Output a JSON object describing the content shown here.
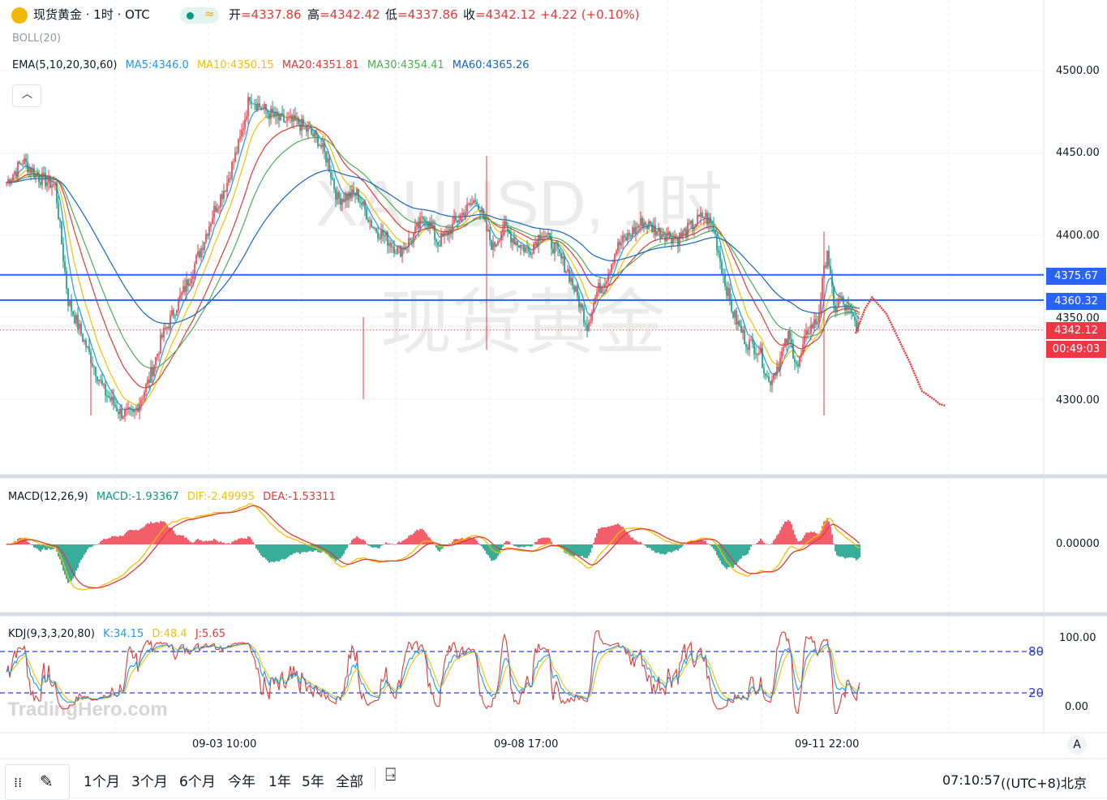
{
  "header": {
    "symbol": "现货黄金 · 1时 · OTC",
    "open_label": "开",
    "open": "=4337.86",
    "high_label": "高",
    "high": "=4342.42",
    "low_label": "低",
    "low": "=4337.86",
    "close_label": "收",
    "close": "=4342.12",
    "change": "+4.22 (+0.10%)",
    "boll": "BOLL(20)"
  },
  "ema_legend": {
    "label": "EMA(5,10,20,30,60)",
    "items": [
      {
        "text": "MA5:4346.0",
        "color": "#2196f3"
      },
      {
        "text": "MA10:4350.15",
        "color": "#f5c000"
      },
      {
        "text": "MA20:4351.81",
        "color": "#e53935"
      },
      {
        "text": "MA30:4354.41",
        "color": "#4caf50"
      },
      {
        "text": "MA60:4365.26",
        "color": "#1565c0"
      }
    ]
  },
  "watermark": {
    "symbol": "XAUUSD, 1时",
    "name": "现货黄金",
    "brand": "TradingHero.com"
  },
  "price_axis": {
    "ticks": [
      "4500.00",
      "4450.00",
      "4400.00",
      "4350.00",
      "4300.00"
    ]
  },
  "price_tags": {
    "level1": "4375.67",
    "level2": "4360.32",
    "current": "4342.12",
    "countdown": "00:49:03"
  },
  "macd": {
    "label": "MACD(12,26,9)",
    "macd": "MACD:-1.93367",
    "dif": "DIF:-2.49995",
    "dea": "DEA:-1.53311",
    "axis": "0.00000"
  },
  "kdj": {
    "label": "KDJ(9,3,3,20,80)",
    "k": "K:34.15",
    "d": "D:48.4",
    "j": "J:5.65",
    "axis_top": "100.00",
    "axis_bottom": "0.00",
    "level_high": "80",
    "level_low": "20"
  },
  "time_axis": {
    "labels": [
      "09-03 10:00",
      "09-08 17:00",
      "09-11 22:00"
    ]
  },
  "toolbar": {
    "ranges": [
      "1个月",
      "3个月",
      "6个月",
      "今年",
      "1年",
      "5年",
      "全部"
    ],
    "clock": "07:10:57",
    "timezone": "((UTC+8)北京",
    "auto": "A"
  },
  "chart_data": {
    "type": "candlestick",
    "title": "现货黄金 · 1时 · OTC",
    "interval": "1h",
    "ylim": [
      4270,
      4520
    ],
    "x_labels": [
      "09-03 10:00",
      "09-08 17:00",
      "09-11 22:00"
    ],
    "ohlc_last": {
      "open": 4337.86,
      "high": 4342.42,
      "low": 4337.86,
      "close": 4342.12
    },
    "horizontal_levels": [
      4375.67,
      4360.32
    ],
    "current_price": 4342.12,
    "price_anchors": [
      [
        0,
        4432
      ],
      [
        10,
        4445
      ],
      [
        20,
        4435
      ],
      [
        30,
        4430
      ],
      [
        38,
        4360
      ],
      [
        48,
        4335
      ],
      [
        60,
        4305
      ],
      [
        70,
        4292
      ],
      [
        78,
        4290
      ],
      [
        88,
        4312
      ],
      [
        96,
        4338
      ],
      [
        104,
        4355
      ],
      [
        112,
        4372
      ],
      [
        120,
        4392
      ],
      [
        128,
        4415
      ],
      [
        136,
        4432
      ],
      [
        144,
        4458
      ],
      [
        150,
        4485
      ],
      [
        156,
        4478
      ],
      [
        168,
        4470
      ],
      [
        180,
        4468
      ],
      [
        192,
        4458
      ],
      [
        198,
        4445
      ],
      [
        204,
        4422
      ],
      [
        216,
        4425
      ],
      [
        226,
        4405
      ],
      [
        234,
        4398
      ],
      [
        242,
        4390
      ],
      [
        250,
        4398
      ],
      [
        258,
        4412
      ],
      [
        266,
        4395
      ],
      [
        274,
        4404
      ],
      [
        282,
        4414
      ],
      [
        290,
        4422
      ],
      [
        294,
        4408
      ],
      [
        300,
        4392
      ],
      [
        306,
        4405
      ],
      [
        314,
        4396
      ],
      [
        322,
        4390
      ],
      [
        330,
        4402
      ],
      [
        338,
        4392
      ],
      [
        346,
        4378
      ],
      [
        352,
        4362
      ],
      [
        358,
        4345
      ],
      [
        364,
        4365
      ],
      [
        370,
        4375
      ],
      [
        376,
        4392
      ],
      [
        384,
        4400
      ],
      [
        392,
        4408
      ],
      [
        402,
        4402
      ],
      [
        414,
        4398
      ],
      [
        422,
        4405
      ],
      [
        430,
        4412
      ],
      [
        436,
        4404
      ],
      [
        442,
        4375
      ],
      [
        448,
        4352
      ],
      [
        456,
        4335
      ],
      [
        464,
        4330
      ],
      [
        470,
        4310
      ],
      [
        476,
        4322
      ],
      [
        482,
        4338
      ],
      [
        488,
        4320
      ],
      [
        494,
        4342
      ],
      [
        500,
        4348
      ],
      [
        506,
        4392
      ],
      [
        510,
        4355
      ],
      [
        514,
        4360
      ],
      [
        520,
        4352
      ],
      [
        526,
        4342
      ]
    ],
    "projection": [
      [
        4328,
        4340
      ],
      [
        4344,
        4355
      ],
      [
        4356,
        4362
      ],
      [
        4380,
        4352
      ],
      [
        4400,
        4337
      ],
      [
        4420,
        4322
      ],
      [
        4440,
        4305
      ],
      [
        4460,
        4300
      ],
      [
        4470,
        4297
      ],
      [
        4480,
        4296
      ]
    ],
    "ema_values": {
      "MA5": 4346.0,
      "MA10": 4350.15,
      "MA20": 4351.81,
      "MA30": 4354.41,
      "MA60": 4365.26
    },
    "macd": {
      "MACD": -1.93367,
      "DIF": -2.49995,
      "DEA": -1.53311
    },
    "kdj": {
      "K": 34.15,
      "D": 48.4,
      "J": 5.65,
      "levels": [
        80,
        20
      ]
    }
  }
}
